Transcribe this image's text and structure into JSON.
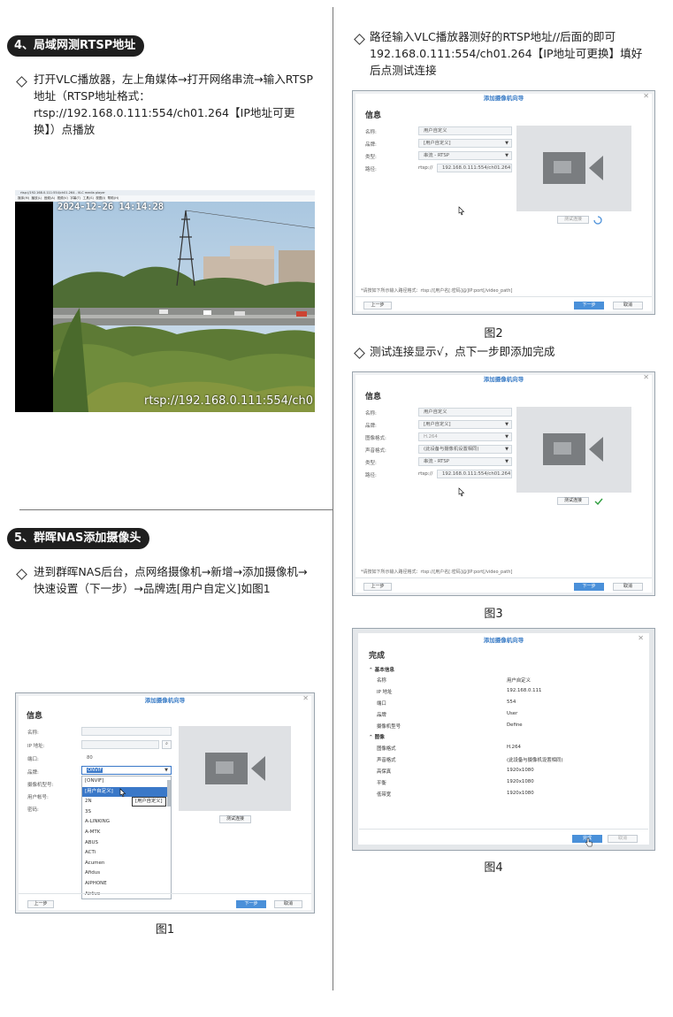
{
  "left": {
    "section4": {
      "title": "4、局域网测RTSP地址",
      "step": "打开VLC播放器，左上角媒体→打开网络串流→输入RTSP地址（RTSP地址格式：rtsp://192.168.0.111:554/ch01.264【IP地址可更换】）点播放"
    },
    "vlc": {
      "window_title": "rtsp://192.168.0.111:554/ch01.264 - VLC media player",
      "menu": [
        "媒体(M)",
        "播放(L)",
        "音频(A)",
        "视频(V)",
        "字幕(T)",
        "工具(S)",
        "视图(I)",
        "帮助(H)"
      ],
      "timestamp": "2024-12-26 14:14:28",
      "overlay_url": "rtsp://192.168.0.111:554/ch0"
    },
    "section5": {
      "title": "5、群晖NAS添加摄像头",
      "step": "进到群晖NAS后台，点网络摄像机→新增→添加摄像机→快速设置（下一步）→品牌选[用户自定义]如图1"
    },
    "fig1": {
      "dialog_title": "添加摄像机向导",
      "heading": "信息",
      "labels": [
        "名称:",
        "IP 地址:",
        "端口:",
        "品牌:",
        "摄像机型号:",
        "用户帐号:",
        "密码:"
      ],
      "port": "80",
      "brand_selected": "ONVIF",
      "options": [
        "[ONVIF]",
        "[用户自定义]",
        "2N",
        "3S",
        "A-LINKING",
        "A-MTK",
        "ABUS",
        "ACTi",
        "Acumen",
        "Afidus",
        "AIPHONE",
        "Airlive"
      ],
      "tooltip": "[用户自定义]",
      "test_button": "测试连接",
      "prev_button": "上一步",
      "next_button": "下一步",
      "cancel_button": "取消",
      "caption": "图1"
    }
  },
  "right": {
    "step_fig2": "路径输入VLC播放器测好的RTSP地址//后面的即可192.168.0.111:554/ch01.264【IP地址可更换】填好后点测试连接",
    "fig2": {
      "dialog_title": "添加摄像机向导",
      "heading": "信息",
      "labels": [
        "名称:",
        "品牌:",
        "类型:",
        "路径:"
      ],
      "values": [
        "用户自定义",
        "[用户自定义]",
        "串流 - RTSP",
        "192.168.0.111:554/ch01.264"
      ],
      "path_prefix": "rtsp://",
      "test_button": "测试连接",
      "hint": "*请按如下所示输入路径格式：rtsp://[用户名[:密码]@]IP:port[/video_path]",
      "prev_button": "上一步",
      "next_button": "下一步",
      "cancel_button": "取消",
      "caption": "图2"
    },
    "step_fig3": "测试连接显示√，点下一步即添加完成",
    "fig3": {
      "dialog_title": "添加摄像机向导",
      "heading": "信息",
      "labels": [
        "名称:",
        "品牌:",
        "图像格式:",
        "声音格式:",
        "类型:",
        "路径:"
      ],
      "values": [
        "用户自定义",
        "[用户自定义]",
        "H.264",
        "(此设备与摄像机设置相同)",
        "串流 - RTSP",
        "192.168.0.111:554/ch01.264"
      ],
      "path_prefix": "rtsp://",
      "test_button": "测试连接",
      "hint": "*请按如下所示输入路径格式：rtsp://[用户名[:密码]@]IP:port[/video_path]",
      "prev_button": "上一步",
      "next_button": "下一步",
      "cancel_button": "取消",
      "caption": "图3"
    },
    "fig4": {
      "dialog_title": "添加摄像机向导",
      "heading": "完成",
      "sections": [
        {
          "name": "基本信息",
          "rows": [
            [
              "名称",
              "用户自定义"
            ],
            [
              "IP 地址",
              "192.168.0.111"
            ],
            [
              "端口",
              "554"
            ],
            [
              "品牌",
              "User"
            ],
            [
              "摄像机型号",
              "Define"
            ]
          ]
        },
        {
          "name": "图像",
          "rows": [
            [
              "图像格式",
              "H.264"
            ],
            [
              "声音格式",
              "(此设备与摄像机设置相同)"
            ],
            [
              "高保真",
              "1920x1080"
            ],
            [
              "平衡",
              "1920x1080"
            ],
            [
              "低带宽",
              "1920x1080"
            ]
          ]
        }
      ],
      "done_button": "完成",
      "cancel_button": "取消",
      "caption": "图4"
    }
  },
  "colors": {
    "accent": "#4a90d9",
    "success": "#2e9e3e"
  }
}
